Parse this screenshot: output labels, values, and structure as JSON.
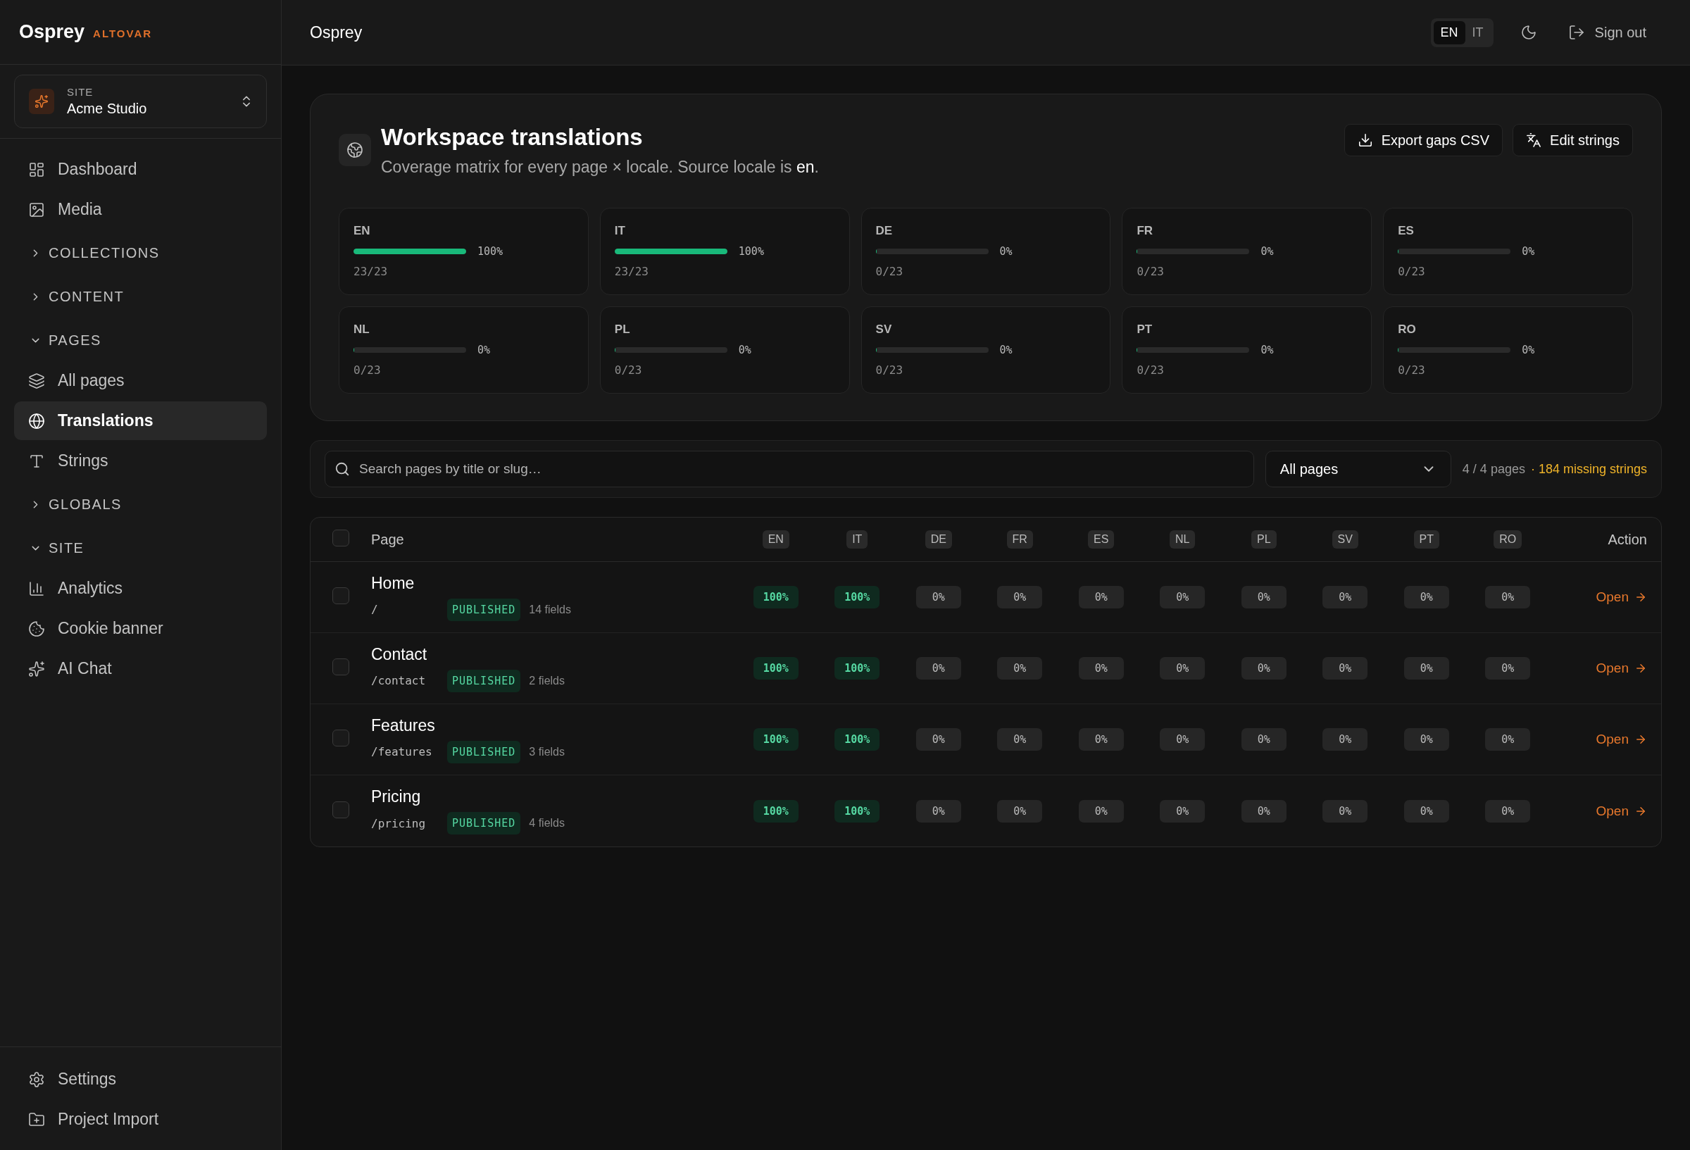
{
  "brand": {
    "name": "Osprey",
    "tag": "ALTOVAR"
  },
  "site_switcher": {
    "label": "SITE",
    "value": "Acme Studio"
  },
  "nav": [
    {
      "kind": "link",
      "label": "Dashboard",
      "selected": false
    },
    {
      "kind": "link",
      "label": "Media",
      "selected": false
    },
    {
      "kind": "section",
      "label": "COLLECTIONS",
      "expanded": false
    },
    {
      "kind": "section",
      "label": "CONTENT",
      "expanded": false
    },
    {
      "kind": "section",
      "label": "PAGES",
      "expanded": true
    },
    {
      "kind": "link",
      "label": "All pages",
      "selected": false
    },
    {
      "kind": "link",
      "label": "Translations",
      "selected": true
    },
    {
      "kind": "link",
      "label": "Strings",
      "selected": false
    },
    {
      "kind": "section",
      "label": "GLOBALS",
      "expanded": false
    },
    {
      "kind": "section",
      "label": "SITE",
      "expanded": true
    },
    {
      "kind": "link",
      "label": "Analytics",
      "selected": false
    },
    {
      "kind": "link",
      "label": "Cookie banner",
      "selected": false
    },
    {
      "kind": "link",
      "label": "AI Chat",
      "selected": false
    }
  ],
  "nav_footer": [
    {
      "label": "Settings"
    },
    {
      "label": "Project Import"
    }
  ],
  "header": {
    "title": "Osprey",
    "languages": [
      {
        "label": "EN",
        "selected": true
      },
      {
        "label": "IT",
        "selected": false
      }
    ],
    "sign_out": "Sign out"
  },
  "panel": {
    "title": "Workspace translations",
    "subtitle": "Coverage matrix for every page × locale. Source locale is **en**.",
    "actions": [
      "Export gaps CSV",
      "Edit strings"
    ],
    "locales": [
      {
        "code": "EN",
        "level": 1,
        "percent": "100%",
        "count": "23/23"
      },
      {
        "code": "IT",
        "level": 1,
        "percent": "100%",
        "count": "23/23"
      },
      {
        "code": "DE",
        "level": 0,
        "percent": "0%",
        "count": "0/23"
      },
      {
        "code": "FR",
        "level": 0,
        "percent": "0%",
        "count": "0/23"
      },
      {
        "code": "ES",
        "level": 0,
        "percent": "0%",
        "count": "0/23"
      },
      {
        "code": "NL",
        "level": 0,
        "percent": "0%",
        "count": "0/23"
      },
      {
        "code": "PL",
        "level": 0,
        "percent": "0%",
        "count": "0/23"
      },
      {
        "code": "SV",
        "level": 0,
        "percent": "0%",
        "count": "0/23"
      },
      {
        "code": "PT",
        "level": 0,
        "percent": "0%",
        "count": "0/23"
      },
      {
        "code": "RO",
        "level": 0,
        "percent": "0%",
        "count": "0/23"
      }
    ]
  },
  "filter": {
    "placeholder": "Search pages by title or slug…",
    "dropdown": "All pages",
    "count": "4 / 4 pages",
    "missing": "· 184 missing strings"
  },
  "table": {
    "select_all": {
      "checked": false
    },
    "columns": [
      "Page",
      "EN",
      "IT",
      "DE",
      "FR",
      "ES",
      "NL",
      "PL",
      "SV",
      "PT",
      "RO",
      "Action"
    ],
    "rows": [
      {
        "checked": false,
        "title": "Home",
        "slug": "/",
        "status": "PUBLISHED",
        "fields": "14 fields",
        "action": "Open",
        "coverage": [
          {
            "value": "100%",
            "complete": true
          },
          {
            "value": "100%",
            "complete": true
          },
          {
            "value": "0%",
            "complete": false
          },
          {
            "value": "0%",
            "complete": false
          },
          {
            "value": "0%",
            "complete": false
          },
          {
            "value": "0%",
            "complete": false
          },
          {
            "value": "0%",
            "complete": false
          },
          {
            "value": "0%",
            "complete": false
          },
          {
            "value": "0%",
            "complete": false
          },
          {
            "value": "0%",
            "complete": false
          }
        ]
      },
      {
        "checked": false,
        "title": "Contact",
        "slug": "/contact",
        "status": "PUBLISHED",
        "fields": "2 fields",
        "action": "Open",
        "coverage": [
          {
            "value": "100%",
            "complete": true
          },
          {
            "value": "100%",
            "complete": true
          },
          {
            "value": "0%",
            "complete": false
          },
          {
            "value": "0%",
            "complete": false
          },
          {
            "value": "0%",
            "complete": false
          },
          {
            "value": "0%",
            "complete": false
          },
          {
            "value": "0%",
            "complete": false
          },
          {
            "value": "0%",
            "complete": false
          },
          {
            "value": "0%",
            "complete": false
          },
          {
            "value": "0%",
            "complete": false
          }
        ]
      },
      {
        "checked": false,
        "title": "Features",
        "slug": "/features",
        "status": "PUBLISHED",
        "fields": "3 fields",
        "action": "Open",
        "coverage": [
          {
            "value": "100%",
            "complete": true
          },
          {
            "value": "100%",
            "complete": true
          },
          {
            "value": "0%",
            "complete": false
          },
          {
            "value": "0%",
            "complete": false
          },
          {
            "value": "0%",
            "complete": false
          },
          {
            "value": "0%",
            "complete": false
          },
          {
            "value": "0%",
            "complete": false
          },
          {
            "value": "0%",
            "complete": false
          },
          {
            "value": "0%",
            "complete": false
          },
          {
            "value": "0%",
            "complete": false
          }
        ]
      },
      {
        "checked": false,
        "title": "Pricing",
        "slug": "/pricing",
        "status": "PUBLISHED",
        "fields": "4 fields",
        "action": "Open",
        "coverage": [
          {
            "value": "100%",
            "complete": true
          },
          {
            "value": "100%",
            "complete": true
          },
          {
            "value": "0%",
            "complete": false
          },
          {
            "value": "0%",
            "complete": false
          },
          {
            "value": "0%",
            "complete": false
          },
          {
            "value": "0%",
            "complete": false
          },
          {
            "value": "0%",
            "complete": false
          },
          {
            "value": "0%",
            "complete": false
          },
          {
            "value": "0%",
            "complete": false
          },
          {
            "value": "0%",
            "complete": false
          }
        ]
      }
    ]
  }
}
